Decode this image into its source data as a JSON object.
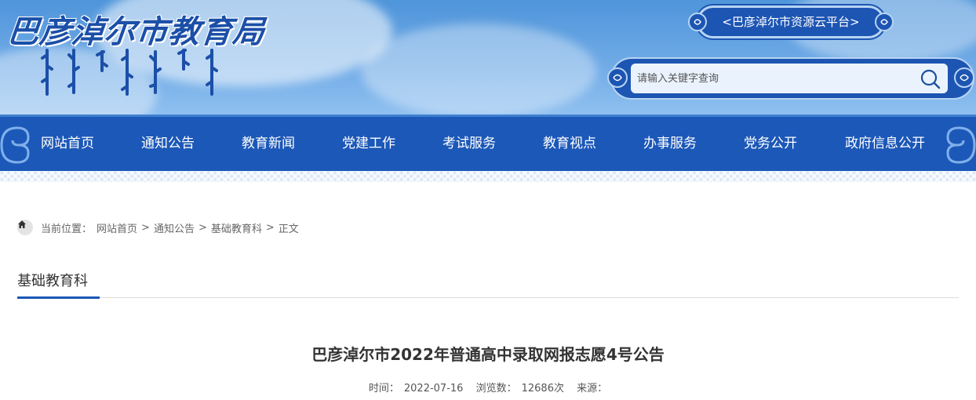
{
  "header": {
    "site_name": "巴彦淖尔市教育局",
    "platform_link": "<巴彦淖尔市资源云平台>",
    "search": {
      "placeholder": "请输入关键字查询",
      "icon": "search-icon"
    }
  },
  "nav": {
    "items": [
      {
        "label": "网站首页"
      },
      {
        "label": "通知公告"
      },
      {
        "label": "教育新闻"
      },
      {
        "label": "党建工作"
      },
      {
        "label": "考试服务"
      },
      {
        "label": "教育视点"
      },
      {
        "label": "办事服务"
      },
      {
        "label": "党务公开"
      },
      {
        "label": "政府信息公开"
      }
    ]
  },
  "breadcrumb": {
    "icon": "home-icon",
    "prefix": "当前位置：",
    "items": [
      "网站首页",
      "通知公告",
      "基础教育科",
      "正文"
    ],
    "separator": ">"
  },
  "column": {
    "title": "基础教育科"
  },
  "article": {
    "title": "巴彦淖尔市2022年普通高中录取网报志愿4号公告",
    "time_label": "时间：",
    "time": "2022-07-16",
    "views_label": "浏览数：",
    "views": "12686次",
    "source_label": "来源："
  },
  "colors": {
    "primary": "#1c58b8",
    "banner_sky": "#5d9de0",
    "platform_bg": "#1d55b3",
    "search_bg": "#eaf3fd"
  }
}
